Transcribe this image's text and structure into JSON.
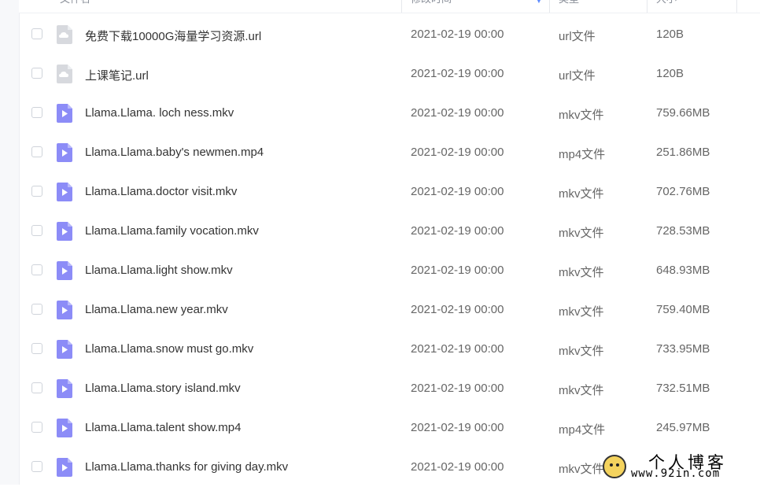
{
  "header": {
    "name_label": "文件名",
    "modified_label": "修改时间",
    "type_label": "类型",
    "size_label": "大小"
  },
  "files": [
    {
      "name": "免费下载10000G海量学习资源.url",
      "modified": "2021-02-19 00:00",
      "type": "url文件",
      "size": "120B",
      "icon": "cloud-link-icon"
    },
    {
      "name": "上课笔记.url",
      "modified": "2021-02-19 00:00",
      "type": "url文件",
      "size": "120B",
      "icon": "cloud-link-icon"
    },
    {
      "name": "Llama.Llama. loch ness.mkv",
      "modified": "2021-02-19 00:00",
      "type": "mkv文件",
      "size": "759.66MB",
      "icon": "video-file-icon"
    },
    {
      "name": "Llama.Llama.baby's newmen.mp4",
      "modified": "2021-02-19 00:00",
      "type": "mp4文件",
      "size": "251.86MB",
      "icon": "video-file-icon"
    },
    {
      "name": "Llama.Llama.doctor visit.mkv",
      "modified": "2021-02-19 00:00",
      "type": "mkv文件",
      "size": "702.76MB",
      "icon": "video-file-icon"
    },
    {
      "name": "Llama.Llama.family vocation.mkv",
      "modified": "2021-02-19 00:00",
      "type": "mkv文件",
      "size": "728.53MB",
      "icon": "video-file-icon"
    },
    {
      "name": "Llama.Llama.light show.mkv",
      "modified": "2021-02-19 00:00",
      "type": "mkv文件",
      "size": "648.93MB",
      "icon": "video-file-icon"
    },
    {
      "name": "Llama.Llama.new year.mkv",
      "modified": "2021-02-19 00:00",
      "type": "mkv文件",
      "size": "759.40MB",
      "icon": "video-file-icon"
    },
    {
      "name": "Llama.Llama.snow must go.mkv",
      "modified": "2021-02-19 00:00",
      "type": "mkv文件",
      "size": "733.95MB",
      "icon": "video-file-icon"
    },
    {
      "name": "Llama.Llama.story island.mkv",
      "modified": "2021-02-19 00:00",
      "type": "mkv文件",
      "size": "732.51MB",
      "icon": "video-file-icon"
    },
    {
      "name": "Llama.Llama.talent show.mp4",
      "modified": "2021-02-19 00:00",
      "type": "mp4文件",
      "size": "245.97MB",
      "icon": "video-file-icon"
    },
    {
      "name": "Llama.Llama.thanks for giving day.mkv",
      "modified": "2021-02-19 00:00",
      "type": "mkv文件",
      "size": "",
      "icon": "video-file-icon"
    }
  ],
  "watermark": {
    "title": "个人博客",
    "url": "www.92in.com"
  },
  "colors": {
    "video_icon": "#8c8cf7",
    "url_icon": "#d7d9de",
    "sort_accent": "#5f8cff"
  }
}
